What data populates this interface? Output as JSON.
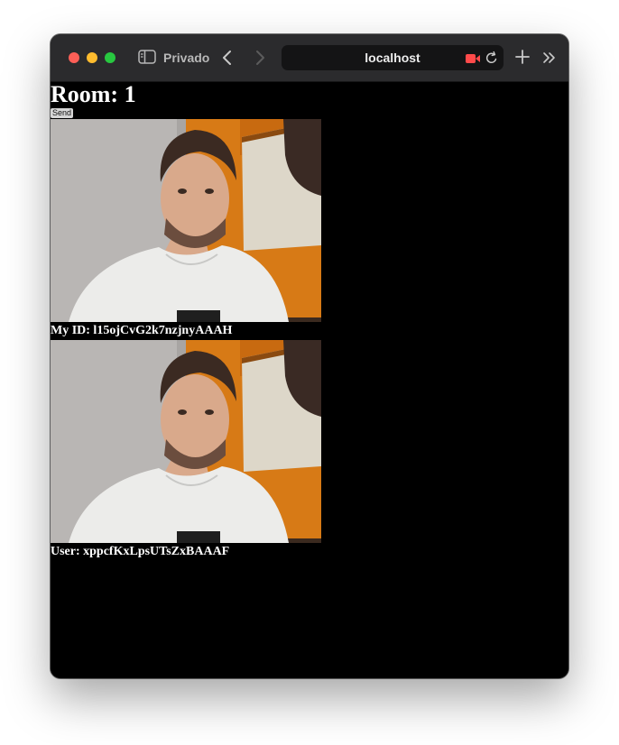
{
  "browser": {
    "private_label": "Privado",
    "address": "localhost",
    "colors": {
      "close": "#fe5f57",
      "minimize": "#febc2e",
      "maximize": "#28c840",
      "camera_indicator": "#ff4a4a"
    }
  },
  "page": {
    "room_title": "Room: 1",
    "send_label": "Send",
    "local_caption": "My ID: l15ojCvG2k7nzjnyAAAH",
    "remote_caption": "User: xppcfKxLpsUTsZxBAAAF"
  }
}
